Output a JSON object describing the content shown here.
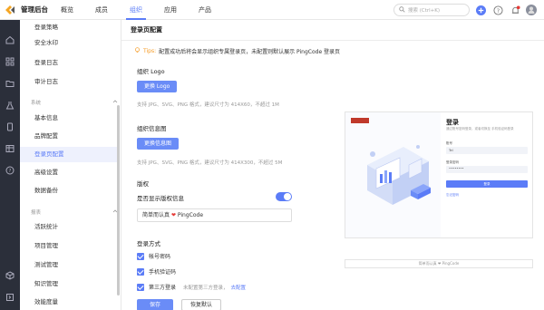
{
  "header": {
    "app_title": "管理后台",
    "nav": [
      "概览",
      "成员",
      "组织",
      "应用",
      "产品"
    ],
    "active_nav": 2,
    "search_placeholder": "搜索 (Ctrl+K)",
    "accent_color": "#5b7cf7"
  },
  "rail": {
    "icons": [
      "home-icon",
      "grid-icon",
      "folder-icon",
      "flask-icon",
      "device-icon",
      "table-icon",
      "help-icon",
      "cube-icon"
    ]
  },
  "sidebar": {
    "items_top": [
      "登录策略",
      "安全水印",
      "登录日志",
      "审计日志"
    ],
    "group_system": "系统",
    "items_system": [
      "基本信息",
      "品牌配置",
      "登录页配置",
      "高级设置",
      "数据备份"
    ],
    "group_report": "报表",
    "items_report": [
      "活跃统计",
      "项目管理",
      "测试管理",
      "知识管理",
      "效能度量"
    ],
    "active_item": "登录页配置"
  },
  "main": {
    "title": "登录页配置",
    "tip_label": "Tips:",
    "tip_text": "配置成功后将会显示组织专属登录页，未配置则默认展示 PingCode 登录页",
    "logo_label": "组织 Logo",
    "logo_button": "更换 Logo",
    "logo_hint": "支持 JPG、SVG、PNG 格式，建议尺寸为 414X60，不超过 1M",
    "image_label": "组织信息图",
    "image_button": "更换信息图",
    "image_hint": "支持 JPG、SVG、PNG 格式，建议尺寸为 414X300，不超过 5M",
    "copyright_label": "版权",
    "copyright_toggle_label": "是否显示版权信息",
    "copyright_toggle_on": true,
    "copyright_prefix": "简单而认真",
    "copyright_heart": "❤",
    "copyright_suffix": "PingCode",
    "login_methods_label": "登录方式",
    "methods": [
      {
        "label": "帐号密码",
        "checked": true
      },
      {
        "label": "手机验证码",
        "checked": true
      },
      {
        "label": "第三方登录",
        "checked": true
      }
    ],
    "third_party_note": "未配置第三方登录，",
    "third_party_link": "去配置",
    "save_button": "保存",
    "reset_button": "恢复默认"
  },
  "preview": {
    "title": "登录",
    "subtitle": "通过账号密码登录，或者切换至 手机验证码登录",
    "account_label": "账号",
    "account_value": "Tel",
    "password_label": "登录密码",
    "password_value": "••••••••",
    "login_button": "登录",
    "forgot_link": "忘记密码",
    "footer": "简单而认真 ❤ PingCode"
  }
}
